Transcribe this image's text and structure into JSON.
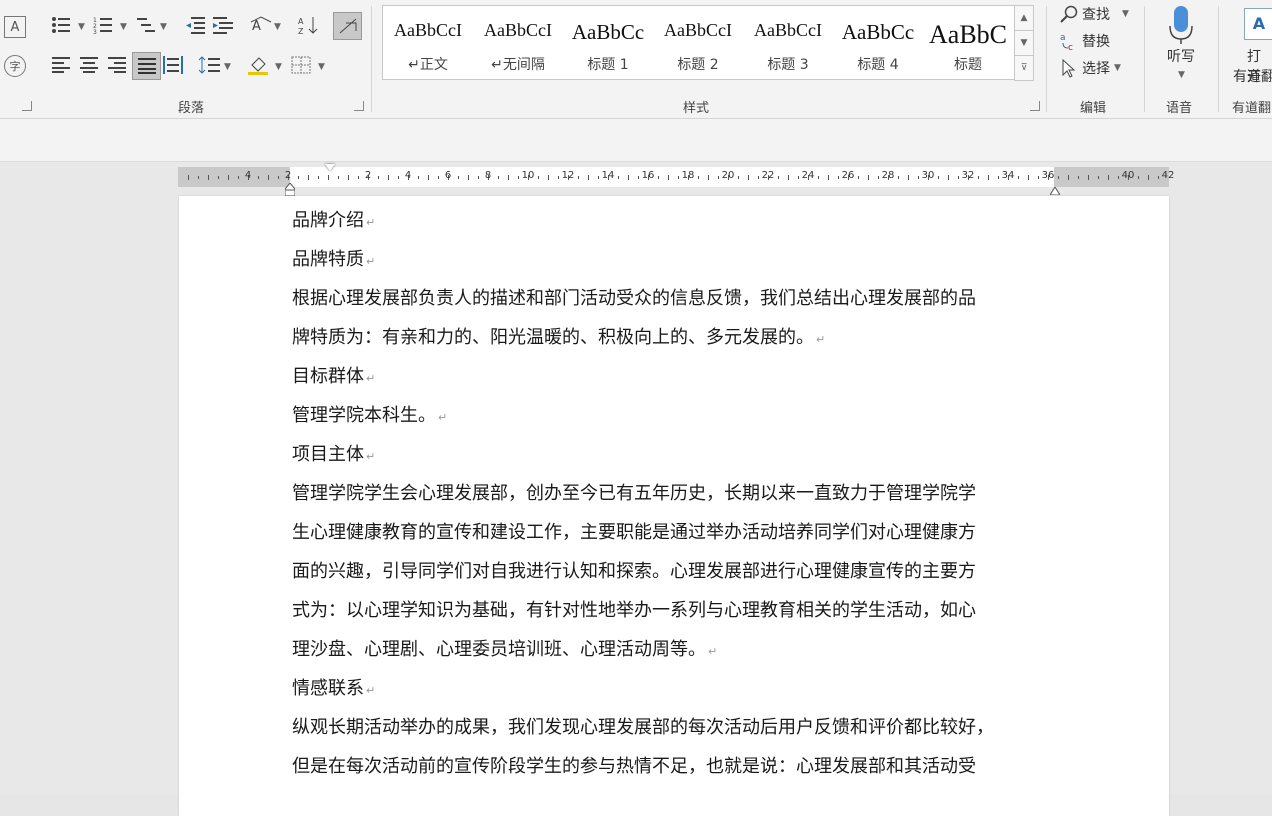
{
  "ribbon": {
    "paragraph_label": "段落",
    "styles_label": "样式",
    "editing_label": "编辑",
    "voice_label": "语音",
    "youdao_label": "有道翻",
    "styles": [
      {
        "sample": "AaBbCcI",
        "name": "↵正文",
        "size": "18px"
      },
      {
        "sample": "AaBbCcI",
        "name": "↵无间隔",
        "size": "18px"
      },
      {
        "sample": "AaBbCc",
        "name": "标题 1",
        "size": "21px"
      },
      {
        "sample": "AaBbCcI",
        "name": "标题 2",
        "size": "18px"
      },
      {
        "sample": "AaBbCcI",
        "name": "标题 3",
        "size": "18px"
      },
      {
        "sample": "AaBbCc",
        "name": "标题 4",
        "size": "21px"
      },
      {
        "sample": "AaBbC",
        "name": "标题",
        "size": "26px"
      }
    ],
    "find_label": "查找",
    "replace_label": "替换",
    "select_label": "选择",
    "dictate_label": "听写",
    "youdao_open_label": "打开",
    "youdao_open_sub": "有道翻"
  },
  "ruler": {
    "numbers": [
      "4",
      "2",
      "2",
      "4",
      "6",
      "8",
      "10",
      "12",
      "14",
      "16",
      "18",
      "20",
      "22",
      "24",
      "26",
      "28",
      "30",
      "32",
      "34",
      "36",
      "40",
      "42"
    ]
  },
  "document": {
    "paragraphs": [
      "品牌介绍",
      "品牌特质",
      "根据心理发展部负责人的描述和部门活动受众的信息反馈，我们总结出心理发展部的品",
      "牌特质为：有亲和力的、阳光温暖的、积极向上的、多元发展的。",
      "目标群体",
      "管理学院本科生。",
      "项目主体",
      "管理学院学生会心理发展部，创办至今已有五年历史，长期以来一直致力于管理学院学",
      "生心理健康教育的宣传和建设工作，主要职能是通过举办活动培养同学们对心理健康方",
      "面的兴趣，引导同学们对自我进行认知和探索。心理发展部进行心理健康宣传的主要方",
      "式为：以心理学知识为基础，有针对性地举办一系列与心理教育相关的学生活动，如心",
      "理沙盘、心理剧、心理委员培训班、心理活动周等。",
      "情感联系",
      "纵观长期活动举办的成果，我们发现心理发展部的每次活动后用户反馈和评价都比较好，",
      "但是在每次活动前的宣传阶段学生的参与热情不足，也就是说：心理发展部和其活动受"
    ],
    "paragraph_mark": "↵"
  }
}
